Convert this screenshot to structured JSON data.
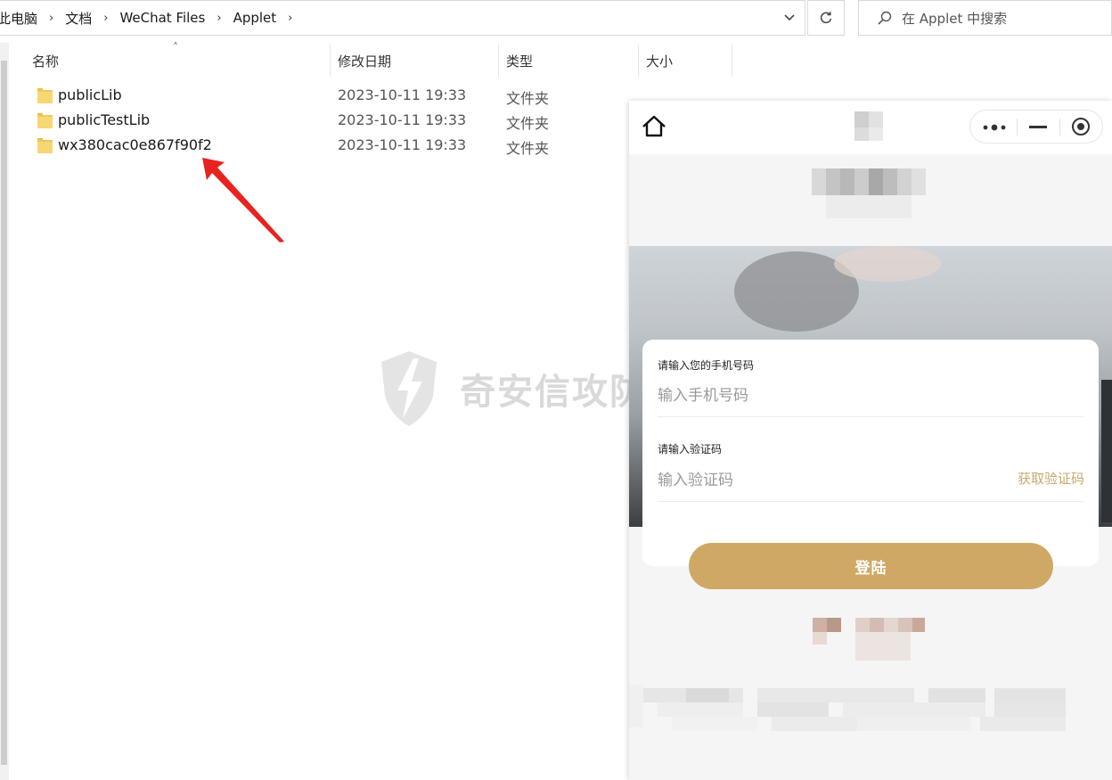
{
  "explorer": {
    "breadcrumb": [
      "此电脑",
      "文档",
      "WeChat Files",
      "Applet"
    ],
    "search_placeholder": "在 Applet 中搜索",
    "columns": {
      "name": "名称",
      "modified": "修改日期",
      "type": "类型",
      "size": "大小"
    },
    "files": [
      {
        "name": "publicLib",
        "modified": "2023-10-11 19:33",
        "type": "文件夹"
      },
      {
        "name": "publicTestLib",
        "modified": "2023-10-11 19:33",
        "type": "文件夹"
      },
      {
        "name": "wx380cac0e867f90f2",
        "modified": "2023-10-11 19:33",
        "type": "文件夹"
      }
    ]
  },
  "watermark": {
    "text": "奇安信攻防社区"
  },
  "miniprogram": {
    "phone_label": "请输入您的手机号码",
    "phone_placeholder": "输入手机号码",
    "code_label": "请输入验证码",
    "code_placeholder": "输入验证码",
    "get_code": "获取验证码",
    "login": "登陆",
    "accent_color": "#d0a866"
  },
  "colors": {
    "annotation_arrow": "#e8231e",
    "folder": "#f7d774"
  }
}
